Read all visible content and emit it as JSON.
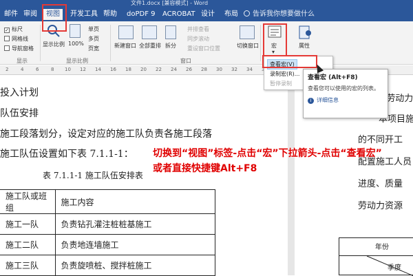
{
  "window": {
    "title_fragment": "文件1.docx [兼容模式] - Word"
  },
  "tabs": [
    "邮件",
    "审阅",
    "视图",
    "开发工具",
    "帮助",
    "doPDF 9",
    "ACROBAT",
    "设计",
    "布局"
  ],
  "active_tab": "视图",
  "tell_me": "告诉我你想要做什么",
  "ribbon": {
    "show_group": {
      "checkboxes": [
        {
          "label": "标尺",
          "checked": true
        },
        {
          "label": "网格线",
          "checked": false
        },
        {
          "label": "导航窗格",
          "checked": false
        }
      ],
      "label": "显示"
    },
    "zoom_group": {
      "zoom_label": "显示比例",
      "percent_label": "100%",
      "single_page": "单页",
      "multi_page": "多页",
      "page_width": "页宽",
      "label": "显示比例"
    },
    "window_group": {
      "new_window": "新建窗口",
      "arrange_all": "全部重排",
      "split": "拆分",
      "side_by_side": "并排查看",
      "sync_scroll": "同步滚动",
      "reset_position": "重设窗口位置",
      "switch_window": "切换窗口",
      "label": "窗口"
    },
    "macro_group": {
      "macros": "宏",
      "properties": "属性"
    }
  },
  "macro_menu": {
    "items": [
      {
        "label": "查看宏(V)",
        "highlighted": true
      },
      {
        "label": "录制宏(R)...",
        "highlighted": false
      },
      {
        "label": "暂停录制",
        "highlighted": false
      }
    ]
  },
  "tooltip": {
    "title": "查看宏 (Alt+F8)",
    "body": "查看您可以使用的宏的列表。",
    "link": "详细信息"
  },
  "ruler_numbers": [
    "2",
    "4",
    "6",
    "8",
    "10",
    "12",
    "14",
    "16",
    "18",
    "20",
    "22",
    "24",
    "26",
    "28",
    "30",
    "32",
    "34",
    "36",
    "38"
  ],
  "document": {
    "lines": [
      "投入计划",
      "队伍安排",
      "施工段落划分，设定对应的施工队负责各施工段落",
      "施工队伍设置如下表 7.1.1-1：",
      "表 7.1.1-1 施工队伍安排表"
    ],
    "table": {
      "headers": [
        "施工队或班组",
        "施工内容"
      ],
      "rows": [
        [
          "施工一队",
          "负责钻孔灌注桩桩基施工"
        ],
        [
          "施工二队",
          "负责地连墙施工"
        ],
        [
          "施工三队",
          "负责旋喷桩、搅拌桩施工"
        ]
      ]
    },
    "right_page": {
      "lines": [
        "7.1.2 劳动力",
        "本项目施",
        "的不同开工",
        "配置施工人员",
        "进度、质量",
        "劳动力资源"
      ],
      "table_labels": [
        "年份",
        "季度"
      ]
    }
  },
  "annotation": {
    "line1": "切换到“视图”标签-点击“宏”下拉箭头-点击“查看宏”",
    "line2": "或者直接快捷键Alt+F8",
    "color": "#e00000"
  },
  "colors": {
    "ribbon_blue": "#2b579a",
    "highlight_red": "#e53935"
  }
}
